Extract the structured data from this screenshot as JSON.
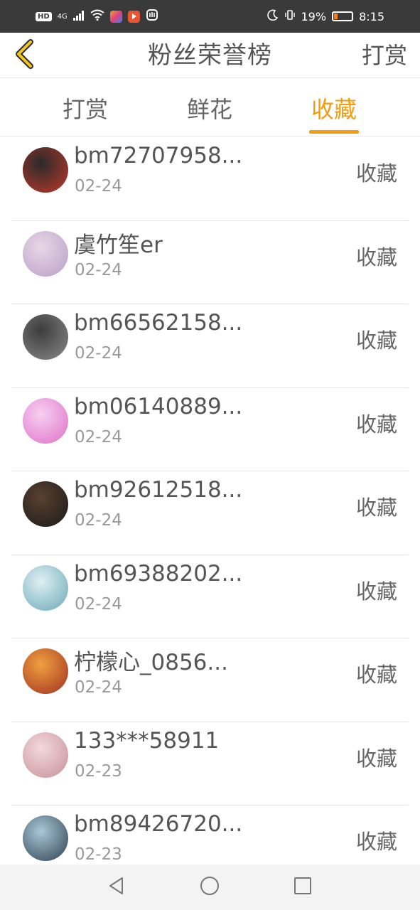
{
  "status_bar": {
    "hd": "HD",
    "signal": "4G",
    "battery_pct": "19%",
    "battery_level": 0.19,
    "time": "8:15"
  },
  "header": {
    "title": "粉丝荣誉榜",
    "action": "打赏",
    "back_icon": "chevron-left-icon",
    "accent": "#f39c12"
  },
  "tabs": [
    {
      "label": "打赏",
      "active": false
    },
    {
      "label": "鲜花",
      "active": false
    },
    {
      "label": "收藏",
      "active": true
    }
  ],
  "list": [
    {
      "name": "bm72707958...",
      "date": "02-24",
      "action": "收藏",
      "avatar_colors": [
        "#2a2a2a",
        "#c0392b"
      ]
    },
    {
      "name": "虞竹笙er",
      "date": "02-24",
      "action": "收藏",
      "avatar_colors": [
        "#e9d6e6",
        "#b8a0c8"
      ]
    },
    {
      "name": "bm66562158...",
      "date": "02-24",
      "action": "收藏",
      "avatar_colors": [
        "#3c3c3c",
        "#8a8a8a"
      ]
    },
    {
      "name": "bm06140889...",
      "date": "02-24",
      "action": "收藏",
      "avatar_colors": [
        "#f6d0f0",
        "#e070c8"
      ]
    },
    {
      "name": "bm92612518...",
      "date": "02-24",
      "action": "收藏",
      "avatar_colors": [
        "#5a4030",
        "#1a1a1a"
      ]
    },
    {
      "name": "bm69388202...",
      "date": "02-24",
      "action": "收藏",
      "avatar_colors": [
        "#dff0f2",
        "#6aa8b8"
      ]
    },
    {
      "name": "柠檬心_0856...",
      "date": "02-24",
      "action": "收藏",
      "avatar_colors": [
        "#f0a040",
        "#a03020"
      ]
    },
    {
      "name": "133***58911",
      "date": "02-23",
      "action": "收藏",
      "avatar_colors": [
        "#f2d8dc",
        "#c89098"
      ]
    },
    {
      "name": "bm89426720...",
      "date": "02-23",
      "action": "收藏",
      "avatar_colors": [
        "#a8c8d8",
        "#304050"
      ]
    }
  ],
  "navbar": {
    "back_icon": "triangle-back-icon",
    "home_icon": "circle-home-icon",
    "recents_icon": "square-recents-icon"
  }
}
